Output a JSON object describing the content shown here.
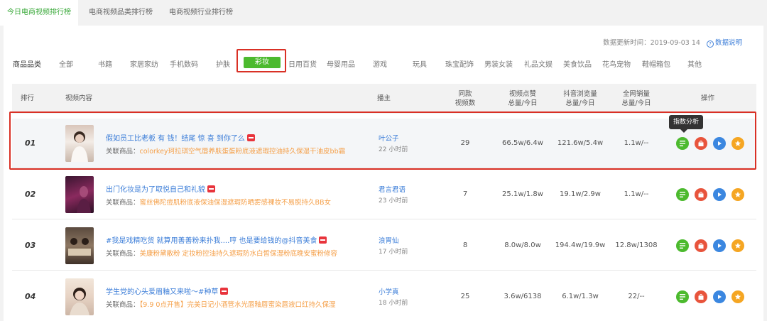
{
  "tabs": [
    {
      "label": "今日电商视频排行榜",
      "active": true
    },
    {
      "label": "电商视频品类排行榜",
      "active": false
    },
    {
      "label": "电商视频行业排行榜",
      "active": false
    }
  ],
  "update": {
    "label": "数据更新时间：",
    "time": "2019-09-03 14",
    "help": "数据说明"
  },
  "categories": {
    "label": "商品品类",
    "items": [
      "全部",
      "书籍",
      "家居家纺",
      "手机数码",
      "护肤",
      "彩妆",
      "日用百货",
      "母婴用品",
      "游戏",
      "玩具",
      "珠宝配饰",
      "男装女装",
      "礼品文娱",
      "美食饮品",
      "花鸟宠物",
      "鞋帽箱包",
      "其他"
    ],
    "active": "彩妆"
  },
  "table": {
    "headers": {
      "rank": "排行",
      "content": "视频内容",
      "anchor": "播主",
      "same_videos": [
        "同款",
        "视频数"
      ],
      "likes": [
        "视频点赞",
        "总量/今日"
      ],
      "views": [
        "抖音浏览量",
        "总量/今日"
      ],
      "sales": [
        "全网销量",
        "总量/今日"
      ],
      "ops": "操作"
    },
    "goods_label": "关联商品：",
    "rows": [
      {
        "rank": "01",
        "title": "假如员工比老板 有 钱！结尾 惊 喜 到你了么",
        "goods": "colorkey珂拉琪空气唇养肤蛋蛋粉底液遮瑕控油持久保湿干油皮bb霜",
        "anchor": "叶公子",
        "time": "22 小时前",
        "same": "29",
        "likes": "66.5w/6.4w",
        "views": "121.6w/5.4w",
        "sales": "1.1w/--"
      },
      {
        "rank": "02",
        "title": "出门化妆是为了取悦自己和礼貌",
        "goods": "蜜丝佛陀痘肌粉底液保油保湿遮瑕防晒雾感裸妆不易脱持久BB女",
        "anchor": "君言君语",
        "time": "23 小时前",
        "same": "7",
        "likes": "25.1w/1.8w",
        "views": "19.1w/2.9w",
        "sales": "1.1w/--"
      },
      {
        "rank": "03",
        "title": "#我是戏精吃货 就算用善善粉来扑我....哼 也是要给钱的@抖音美食",
        "goods": "美康粉黛散粉 定妆粉控油持久遮瑕防水白皙保湿粉底晚安蜜粉修容",
        "anchor": "浪胃仙",
        "time": "17 小时前",
        "same": "8",
        "likes": "8.0w/8.0w",
        "views": "194.4w/19.9w",
        "sales": "12.8w/1308"
      },
      {
        "rank": "04",
        "title": "学生党的心头爱眉釉又来啦～#种草",
        "goods": "【9.9 0点开售】完美日记小酒管水光唇釉唇蜜染唇液口红持久保湿",
        "anchor": "小学真",
        "time": "18 小时前",
        "same": "25",
        "likes": "3.6w/6138",
        "views": "6.1w/1.3w",
        "sales": "22/--"
      }
    ]
  },
  "tooltip": "指数分析",
  "colors": {
    "accent": "#4cba2e",
    "link": "#3b7dd8",
    "goods": "#f5a04a",
    "highlight_border": "#d93025"
  }
}
